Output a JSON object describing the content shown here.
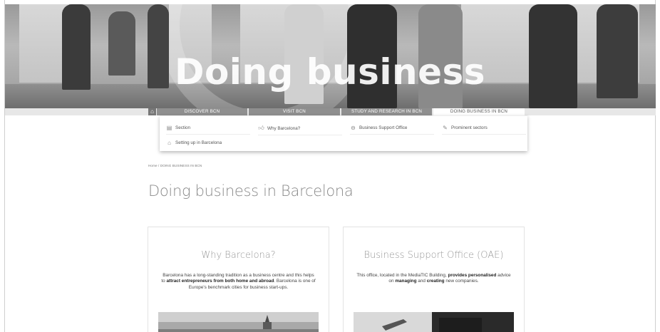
{
  "hero": {
    "title": "Doing business"
  },
  "nav": {
    "home_icon": "home-icon",
    "tabs": [
      {
        "label": "DISCOVER BCN"
      },
      {
        "label": "VISIT BCN"
      },
      {
        "label": "STUDY AND RESEARCH IN BCN"
      },
      {
        "label": "DOING BUSINESS IN BCN"
      }
    ]
  },
  "dropdown": {
    "items": [
      {
        "label": "Section",
        "icon": "document-icon"
      },
      {
        "label": "Why Barcelona?",
        "icon": "thumbs-up-icon"
      },
      {
        "label": "Business Support Office",
        "icon": "office-icon"
      },
      {
        "label": "Prominent sectors",
        "icon": "pencil-icon"
      },
      {
        "label": "Setting up in Barcelona",
        "icon": "building-icon"
      }
    ]
  },
  "breadcrumb": {
    "home": "Home",
    "separator": "/",
    "current": "DOING BUSINESS IN BCN"
  },
  "page_title": "Doing business in Barcelona",
  "cards": [
    {
      "title": "Why Barcelona?",
      "text_parts": [
        "Barcelona has a long-standing tradition as a business centre and this helps to ",
        "attract entrepreneurs from both home and abroad",
        ". Barcelona is one of Europe's benchmark cities for business start-ups."
      ]
    },
    {
      "title": "Business Support Office (OAE)",
      "text_parts": [
        "This office, located in the MediaTIC Building, ",
        "provides personalised",
        " advice on ",
        "managing",
        " and ",
        "creating",
        " new companies."
      ]
    }
  ],
  "colors": {
    "tab_bg": "#8f8f8f",
    "active_tab_bg": "#ffffff",
    "title_gray": "#8a8a8a"
  }
}
